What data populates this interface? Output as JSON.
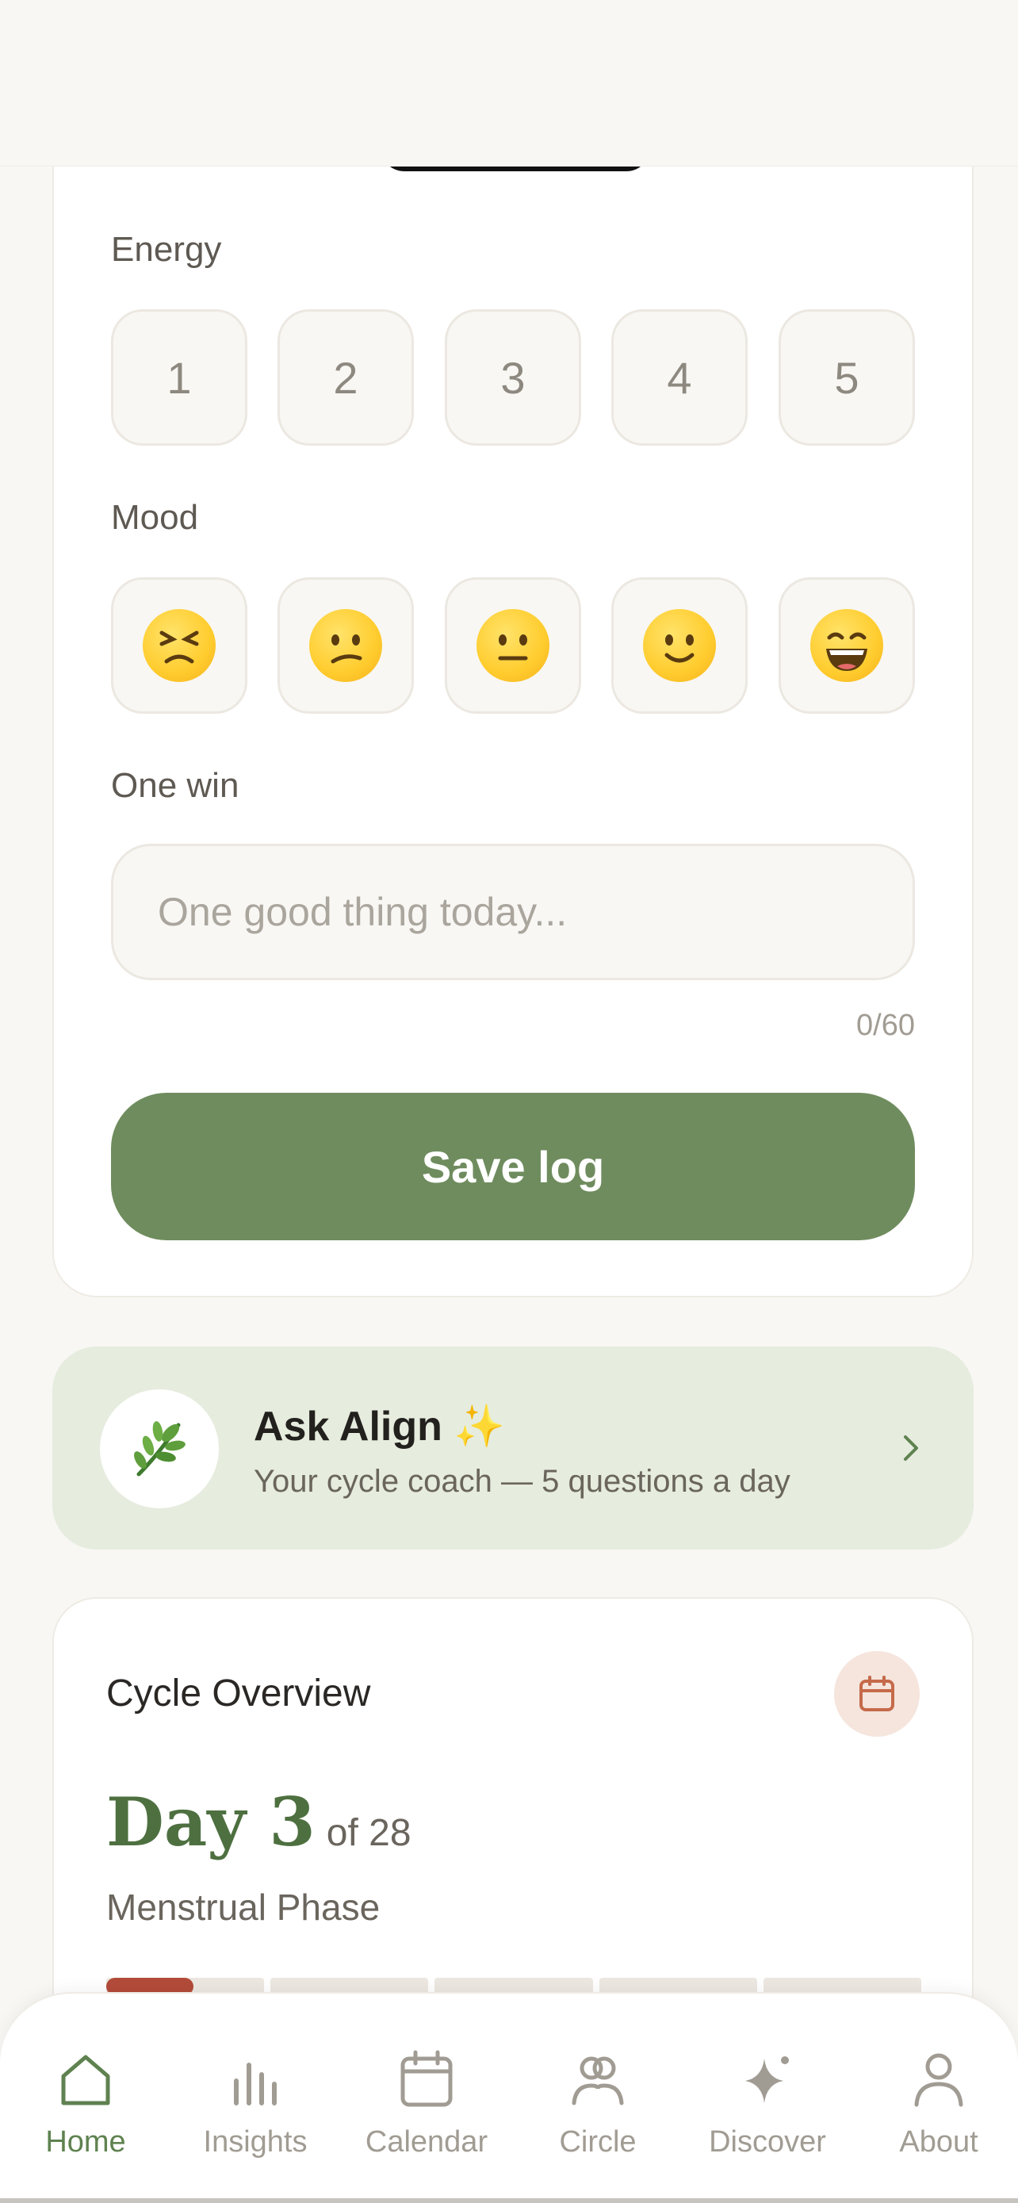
{
  "energy": {
    "label": "Energy",
    "options": [
      "1",
      "2",
      "3",
      "4",
      "5"
    ]
  },
  "mood": {
    "label": "Mood",
    "options": [
      "persevering-face-icon",
      "confused-face-icon",
      "neutral-face-icon",
      "slightly-smiling-face-icon",
      "grinning-face-icon"
    ]
  },
  "win": {
    "label": "One win",
    "placeholder": "One good thing today...",
    "value": "",
    "counter": "0/60"
  },
  "save_label": "Save log",
  "ask": {
    "title": "Ask Align ✨",
    "subtitle": "Your cycle coach — 5 questions a day",
    "icon": "herb-icon"
  },
  "overview": {
    "title": "Cycle Overview",
    "day_label": "Day 3",
    "of_label": "of 28",
    "phase": "Menstrual Phase",
    "progress_fraction": 0.107,
    "phase_color": "#B34B3A"
  },
  "nav": {
    "items": [
      {
        "label": "Home",
        "active": true
      },
      {
        "label": "Insights",
        "active": false
      },
      {
        "label": "Calendar",
        "active": false
      },
      {
        "label": "Circle",
        "active": false
      },
      {
        "label": "Discover",
        "active": false
      },
      {
        "label": "About",
        "active": false
      }
    ]
  },
  "colors": {
    "accent": "#6F8C5E",
    "nav_active": "#5F8250",
    "nav_inactive": "#A19C93"
  }
}
